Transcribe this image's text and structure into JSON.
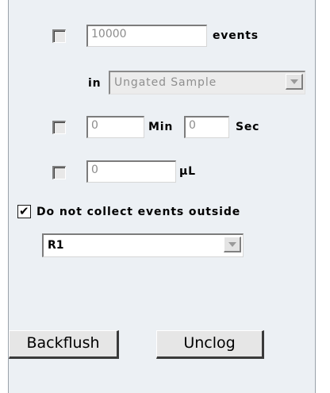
{
  "events": {
    "value": "10000",
    "label": "events",
    "in_label": "in",
    "gate_select": "Ungated Sample",
    "checked": false
  },
  "time": {
    "min_value": "0",
    "min_label": "Min",
    "sec_value": "0",
    "sec_label": "Sec",
    "checked": false
  },
  "volume": {
    "value": "0",
    "unit": "µL",
    "checked": false
  },
  "outside": {
    "label": "Do not collect events outside",
    "checked": true,
    "region_select": "R1"
  },
  "buttons": {
    "backflush": "Backflush",
    "unclog": "Unclog"
  }
}
